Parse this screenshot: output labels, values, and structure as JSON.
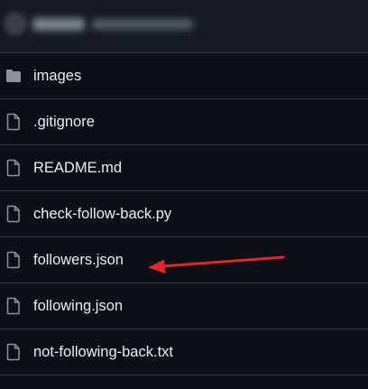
{
  "files": [
    {
      "name": "images",
      "icon": "folder-icon"
    },
    {
      "name": ".gitignore",
      "icon": "file-icon"
    },
    {
      "name": "README.md",
      "icon": "file-icon"
    },
    {
      "name": "check-follow-back.py",
      "icon": "file-icon"
    },
    {
      "name": "followers.json",
      "icon": "file-icon"
    },
    {
      "name": "following.json",
      "icon": "file-icon"
    },
    {
      "name": "not-following-back.txt",
      "icon": "file-icon"
    }
  ],
  "colors": {
    "background": "#0d1117",
    "text": "#e6edf3",
    "icon": "#8b949e",
    "border": "#30363d",
    "annotation_arrow": "#e3242b"
  }
}
